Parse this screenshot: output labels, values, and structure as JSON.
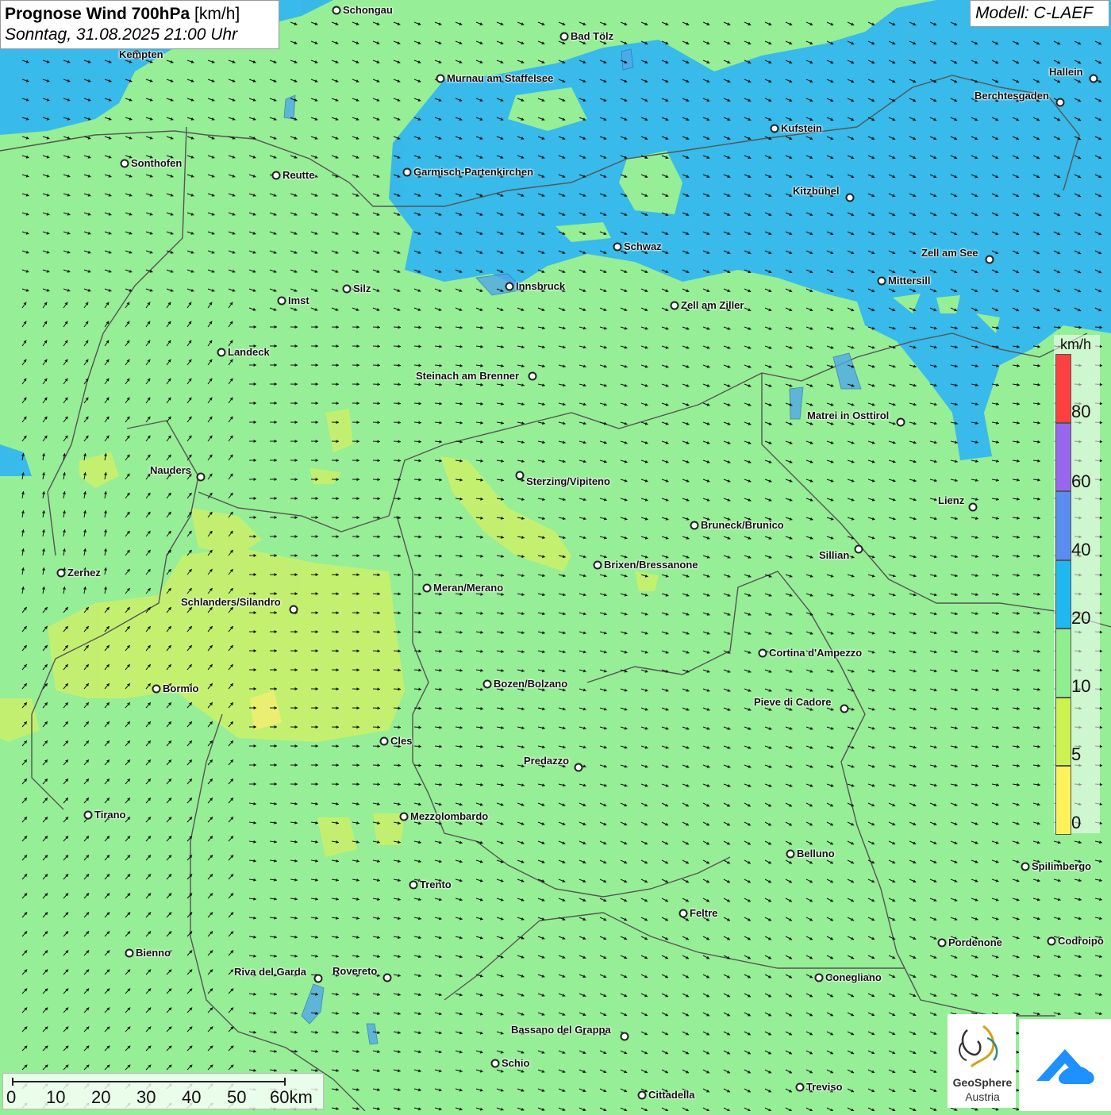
{
  "title": {
    "main": "Prognose Wind 700hPa",
    "unit": "[km/h]",
    "datetime": "Sonntag, 31.08.2025 21:00 Uhr"
  },
  "model": "Modell: C-LAEF",
  "legend": {
    "unit": "km/h",
    "labels": [
      "80",
      "60",
      "40",
      "20",
      "10",
      "5",
      "0"
    ],
    "colors": [
      "#ff4040",
      "#9966ee",
      "#5b8df0",
      "#1fb8f0",
      "#8fee8f",
      "#ccf24f",
      "#fff15a"
    ]
  },
  "scale": {
    "labels": [
      "0",
      "10",
      "20",
      "30",
      "40",
      "50",
      "60km"
    ]
  },
  "logo": {
    "line1": "GeoSphere",
    "line2": "Austria"
  },
  "cities": [
    {
      "name": "Schongau"
    },
    {
      "name": "Bad Tölz"
    },
    {
      "name": "Kempten"
    },
    {
      "name": "Murnau am Staffelsee"
    },
    {
      "name": "Hallein"
    },
    {
      "name": "Berchtesgaden"
    },
    {
      "name": "Kufstein"
    },
    {
      "name": "Sonthofen"
    },
    {
      "name": "Reutte"
    },
    {
      "name": "Garmisch-Partenkirchen"
    },
    {
      "name": "Kitzbühel"
    },
    {
      "name": "Schwaz"
    },
    {
      "name": "Zell am See"
    },
    {
      "name": "Innsbruck"
    },
    {
      "name": "Mittersill"
    },
    {
      "name": "Silz"
    },
    {
      "name": "Imst"
    },
    {
      "name": "Zell am Ziller"
    },
    {
      "name": "Landeck"
    },
    {
      "name": "Steinach am Brenner"
    },
    {
      "name": "Matrei in Osttirol"
    },
    {
      "name": "Nauders"
    },
    {
      "name": "Sterzing/Vipiteno"
    },
    {
      "name": "Lienz"
    },
    {
      "name": "Bruneck/Brunico"
    },
    {
      "name": "Sillian"
    },
    {
      "name": "Zernez"
    },
    {
      "name": "Brixen/Bressanone"
    },
    {
      "name": "Meran/Merano"
    },
    {
      "name": "Schlanders/Silandro"
    },
    {
      "name": "Cortina d'Ampezzo"
    },
    {
      "name": "Bozen/Bolzano"
    },
    {
      "name": "Bormio"
    },
    {
      "name": "Pieve di Cadore"
    },
    {
      "name": "Cles"
    },
    {
      "name": "Predazzo"
    },
    {
      "name": "Tirano"
    },
    {
      "name": "Mezzolombardo"
    },
    {
      "name": "Belluno"
    },
    {
      "name": "Spilimbergo"
    },
    {
      "name": "Trento"
    },
    {
      "name": "Feltre"
    },
    {
      "name": "Pordenone"
    },
    {
      "name": "Codroipo"
    },
    {
      "name": "Bienno"
    },
    {
      "name": "Riva del Garda"
    },
    {
      "name": "Rovereto"
    },
    {
      "name": "Conegliano"
    },
    {
      "name": "Bassano del Grappa"
    },
    {
      "name": "Schio"
    },
    {
      "name": "Treviso"
    },
    {
      "name": "Cittadella"
    }
  ]
}
